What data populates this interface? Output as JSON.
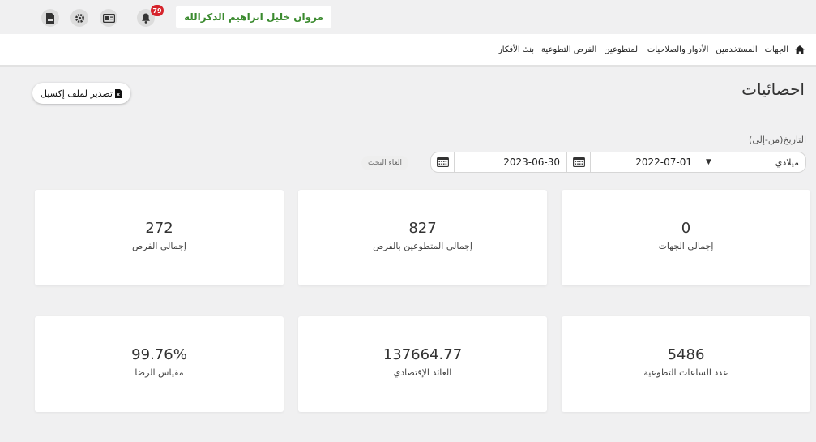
{
  "topbar": {
    "user_name": "مروان خليل ابراهيم الذكرالله",
    "notification_count": "79",
    "icons": [
      "pdf-file-icon",
      "gear-icon",
      "id-card-icon",
      "bell-icon"
    ]
  },
  "nav": {
    "home_icon": "home-icon",
    "items": [
      "الجهات",
      "المستخدمين",
      "الأدوار والصلاحيات",
      "المتطوعين",
      "الفرص التطوعية",
      "بنك الأفكار"
    ]
  },
  "page": {
    "title": "احصائيات",
    "export_label": "تصدير لملف إكسيل"
  },
  "filter": {
    "label": "التاريخ(من-إلى)",
    "calendar_type": "ميلادي",
    "from_date": "2022-07-01",
    "to_date": "2023-06-30",
    "cancel_search": "الغاء البحث"
  },
  "stats": [
    {
      "value": "0",
      "label": "إجمالي الجهات"
    },
    {
      "value": "827",
      "label": "إجمالي المتطوعين بالفرص"
    },
    {
      "value": "272",
      "label": "إجمالي الفرص"
    },
    {
      "value": "5486",
      "label": "عدد الساعات التطوعية"
    },
    {
      "value": "137664.77",
      "label": "العائد الإقتصادي"
    },
    {
      "value": "99.76%",
      "label": "مقياس الرضا"
    }
  ],
  "colors": {
    "background": "#f0f0f1",
    "accent_green": "#3a8a2e",
    "badge_red": "#d6242c"
  }
}
